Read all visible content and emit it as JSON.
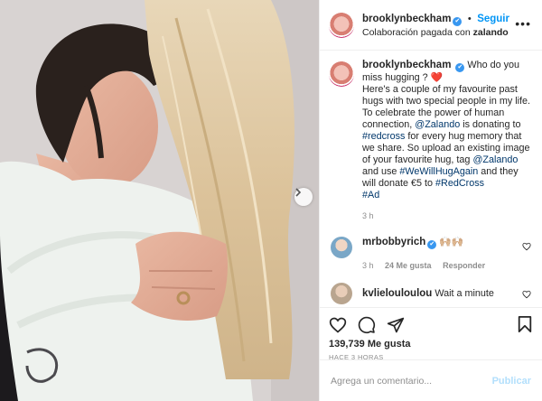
{
  "post": {
    "username": "brooklynbeckham",
    "verified_mark": "✔",
    "dot": "•",
    "follow_label": "Seguir",
    "paid_partnership_prefix": "Colaboración pagada con",
    "partner": "zalando",
    "more_label": "•••"
  },
  "caption": {
    "username": "brooklynbeckham",
    "line1": "Who do you miss hugging ?",
    "heart": "❤️",
    "t1": "Here's a couple of my favourite past hugs with two special people in my life. To celebrate the power of human connection,",
    "m1": "@Zalando",
    "t2": "is donating to",
    "h1": "#redcross",
    "t3": "for every hug memory that we share. So upload an existing image of your favourite hug, tag",
    "m2": "@Zalando",
    "t4": "and use",
    "h2": "#WeWillHugAgain",
    "t5": "and they will donate €5 to",
    "h3": "#RedCross",
    "h4": "#Ad",
    "time": "3 h"
  },
  "comments": [
    {
      "username": "mrbobbyrich",
      "text": "🙌🏼🙌🏼",
      "time": "3 h",
      "likes": "24 Me gusta",
      "reply": "Responder",
      "avatar_color": "#7aa7c7"
    },
    {
      "username": "kvlielouloulou",
      "text": "Wait a minute",
      "avatar_color": "#b9a58f"
    }
  ],
  "actions": {
    "likes": "139,739 Me gusta",
    "timestamp": "HACE 3 HORAS"
  },
  "add_comment": {
    "placeholder": "Agrega un comentario...",
    "publish_label": "Publicar"
  },
  "icons": [
    "heart-icon",
    "comment-icon",
    "share-icon",
    "save-icon",
    "next-arrow-icon",
    "more-icon"
  ]
}
